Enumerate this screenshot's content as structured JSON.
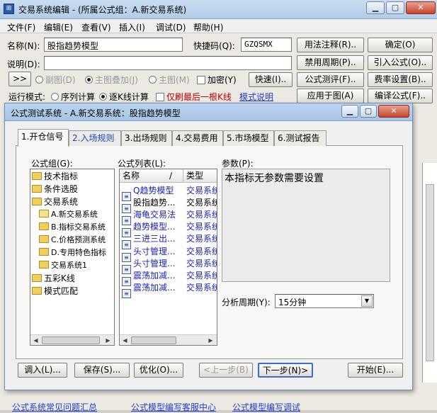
{
  "window": {
    "title": "交易系统编辑 - (所属公式组：A.新交易系统)"
  },
  "menu": [
    "文件(F)",
    "编辑(E)",
    "查看(V)",
    "插入(I)",
    "调试(D)",
    "帮助(H)"
  ],
  "form": {
    "name_label": "名称(N):",
    "name_value": "股指趋势模型",
    "shortcut_label": "快捷码(Q):",
    "shortcut_value": "GZQSMX",
    "desc_label": "说明(D):",
    "expand_btn": ">>",
    "radio_sub": "副图(D)",
    "radio_overlay": "主图叠加(J)",
    "radio_main": "主图(M)",
    "check_encrypt": "加密(Y)",
    "quick_btn": "快速(I)..",
    "run_mode_label": "运行模式:",
    "run_seq": "序列计算",
    "run_kline": "逐K线计算",
    "check_last": "仅刷最后一根K线",
    "mode_help_link": "模式说明"
  },
  "side_buttons": {
    "usage": "用法注释(R)..",
    "ok": "确定(O)",
    "disabled_period": "禁用周期(P)..",
    "import": "引入公式(O)..",
    "test": "公式测评(F)..",
    "fee": "费率设置(B)..",
    "apply": "应用于图(A)",
    "compile": "编译公式(F).."
  },
  "dialog": {
    "title": "公式测试系统 - A.新交易系统：股指趋势模型",
    "tabs": [
      "1.开仓信号",
      "2.入场规则",
      "3.出场规则",
      "4.交易费用",
      "5.市场模型",
      "6.测试报告"
    ],
    "group_label": "公式组(G):",
    "list_label": "公式列表(L):",
    "param_label": "参数(P):",
    "param_text": "本指标无参数需要设置",
    "period_label": "分析周期(Y):",
    "period_value": "15分钟",
    "tree": [
      "技术指标",
      "条件选股",
      "交易系统",
      "A.新交易系统",
      "B.指标交易系统",
      "C.价格预测系统",
      "D.专用特色指标",
      "交易系统1",
      "五彩K线",
      "模式匹配"
    ],
    "list_headers": {
      "name": "名称",
      "sort": "/",
      "type": "类型"
    },
    "formulas": [
      {
        "name": "Q趋势模型",
        "type": "交易系统"
      },
      {
        "name": "股指趋势...",
        "type": "交易系统"
      },
      {
        "name": "海龟交易法",
        "type": "交易系统"
      },
      {
        "name": "趋势模型...",
        "type": "交易系统"
      },
      {
        "name": "三进三出...",
        "type": "交易系统"
      },
      {
        "name": "头寸管理...",
        "type": "交易系统"
      },
      {
        "name": "头寸管理...",
        "type": "交易系统"
      },
      {
        "name": "震荡加减...",
        "type": "交易系统"
      },
      {
        "name": "震荡加减...",
        "type": "交易系统"
      }
    ],
    "buttons": {
      "load": "调入(L)...",
      "save": "保存(S)...",
      "optimize": "优化(O)...",
      "prev": "<上一步(B)",
      "next": "下一步(N)>",
      "start": "开始(E)..."
    }
  },
  "footer_links": [
    "公式系统常见问题汇总",
    "公式模型编写客服中心",
    "公式模型编写调试"
  ]
}
